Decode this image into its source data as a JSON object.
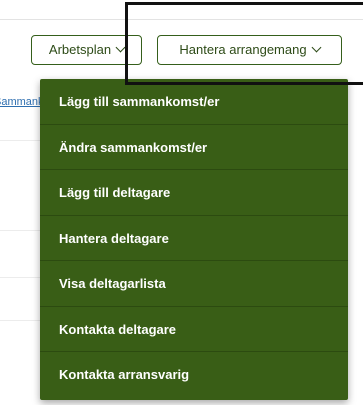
{
  "left_link_text": "Sammankomst",
  "toolbar": {
    "arbetsplan_label": "Arbetsplan",
    "hantera_label": "Hantera arrangemang"
  },
  "menu": {
    "items": [
      {
        "label": "Lägg till sammankomst/er"
      },
      {
        "label": "Ändra sammankomst/er"
      },
      {
        "label": "Lägg till deltagare"
      },
      {
        "label": "Hantera deltagare"
      },
      {
        "label": "Visa deltagarlista"
      },
      {
        "label": "Kontakta deltagare"
      },
      {
        "label": "Kontakta arransvarig"
      }
    ]
  },
  "colors": {
    "menu_bg": "#395e16",
    "button_border": "#355f1b",
    "link": "#2f6fb0"
  },
  "icons": {
    "dropdown": "chevron-down-icon"
  }
}
